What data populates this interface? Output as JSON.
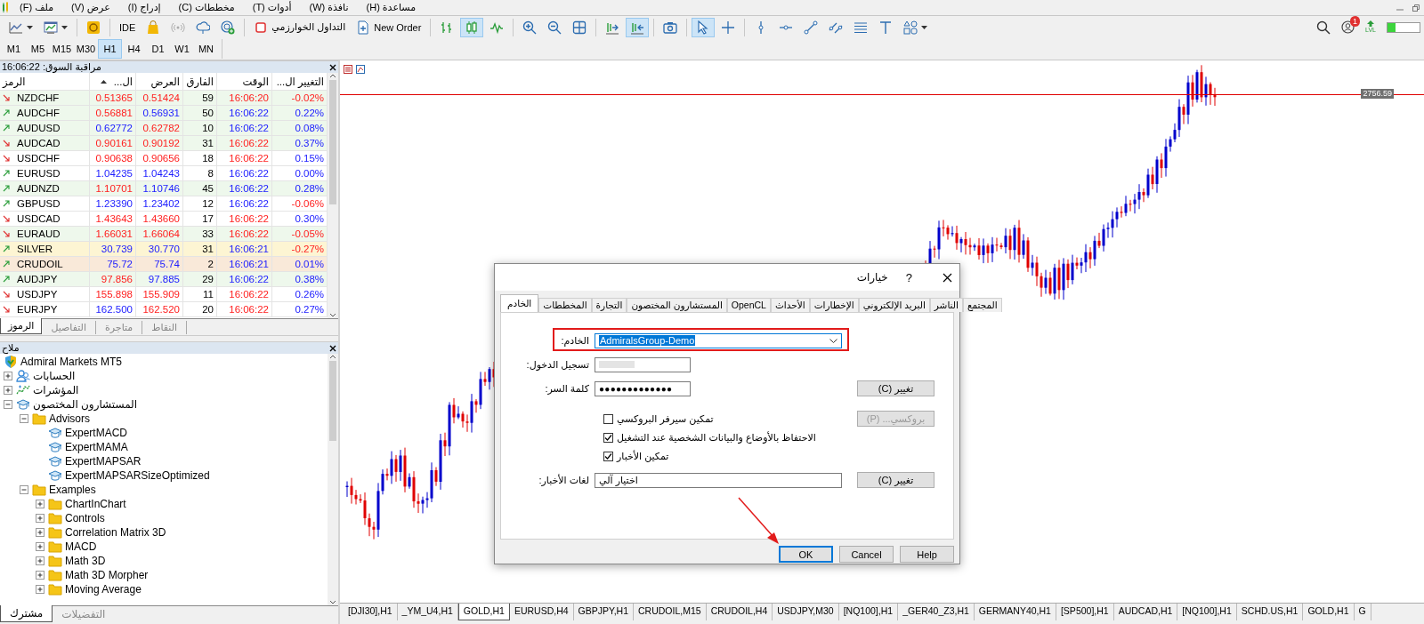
{
  "menu_bar": {
    "items": [
      "مساعدة (H)",
      "نافذة (W)",
      "أدوات (T)",
      "مخططات (C)",
      "إدراج (I)",
      "عرض (V)",
      "ملف (F)"
    ]
  },
  "toolbar": {
    "buttons": [
      {
        "kind": "line-dropdown",
        "selected": false
      },
      {
        "kind": "chart-dropdown",
        "selected": false
      },
      {
        "kind": "coin",
        "selected": false
      },
      {
        "kind": "ide",
        "label": "IDE",
        "selected": false
      },
      {
        "kind": "bag",
        "selected": false
      },
      {
        "kind": "broadcast",
        "selected": false
      },
      {
        "kind": "cloud",
        "selected": false
      },
      {
        "kind": "radar",
        "selected": false
      },
      {
        "kind": "algo",
        "label": "التداول الخوارزمي",
        "selected": false
      },
      {
        "kind": "new-order",
        "label": "New Order",
        "selected": false
      },
      {
        "kind": "bars",
        "selected": false
      },
      {
        "kind": "candles",
        "selected": true
      },
      {
        "kind": "line",
        "selected": false
      },
      {
        "kind": "zoom-in",
        "selected": false
      },
      {
        "kind": "zoom-out",
        "selected": false
      },
      {
        "kind": "tile",
        "selected": false
      },
      {
        "kind": "autoscroll",
        "selected": false
      },
      {
        "kind": "shift",
        "selected": true
      },
      {
        "kind": "camera",
        "selected": false
      },
      {
        "kind": "cursor",
        "selected": true
      },
      {
        "kind": "crosshair",
        "selected": false
      },
      {
        "kind": "vline",
        "selected": false
      },
      {
        "kind": "hline",
        "selected": false
      },
      {
        "kind": "trend",
        "selected": false
      },
      {
        "kind": "channel",
        "selected": false
      },
      {
        "kind": "fibo",
        "selected": false
      },
      {
        "kind": "text",
        "selected": false
      },
      {
        "kind": "shapes",
        "selected": false
      }
    ]
  },
  "status": {
    "notifications": "1",
    "level_label": "LVL",
    "level": 0.25
  },
  "timeframes": [
    {
      "label": "M1",
      "selected": false
    },
    {
      "label": "M5",
      "selected": false
    },
    {
      "label": "M15",
      "selected": false
    },
    {
      "label": "M30",
      "selected": false
    },
    {
      "label": "H1",
      "selected": true
    },
    {
      "label": "H4",
      "selected": false
    },
    {
      "label": "D1",
      "selected": false
    },
    {
      "label": "W1",
      "selected": false
    },
    {
      "label": "MN",
      "selected": false
    }
  ],
  "market_watch": {
    "title": "مراقبة السوق: 16:06:22",
    "columns": [
      {
        "label": "التغيير ال...",
        "sorted": false
      },
      {
        "label": "الوقت",
        "sorted": false
      },
      {
        "label": "الفارق",
        "sorted": false
      },
      {
        "label": "العرض",
        "sorted": false
      },
      {
        "label": "ال...",
        "sorted": true
      },
      {
        "label": "الرمز",
        "sorted": false
      }
    ],
    "rows": [
      {
        "symbol": "NZDCHF",
        "trend_up": false,
        "bid": "0.51365",
        "bid_up": false,
        "ask": "0.51424",
        "ask_up": false,
        "spread": "59",
        "time": "16:06:20",
        "time_up": false,
        "change": "-0.02%",
        "change_up": false,
        "color": "#eef8ec"
      },
      {
        "symbol": "AUDCHF",
        "trend_up": true,
        "bid": "0.56881",
        "bid_up": false,
        "ask": "0.56931",
        "ask_up": true,
        "spread": "50",
        "time": "16:06:22",
        "time_up": true,
        "change": "0.22%",
        "change_up": true,
        "color": "#eef8ec"
      },
      {
        "symbol": "AUDUSD",
        "trend_up": true,
        "bid": "0.62772",
        "bid_up": true,
        "ask": "0.62782",
        "ask_up": false,
        "spread": "10",
        "time": "16:06:22",
        "time_up": true,
        "change": "0.08%",
        "change_up": true,
        "color": "#eef8ec"
      },
      {
        "symbol": "AUDCAD",
        "trend_up": false,
        "bid": "0.90161",
        "bid_up": false,
        "ask": "0.90192",
        "ask_up": false,
        "spread": "31",
        "time": "16:06:22",
        "time_up": false,
        "change": "0.37%",
        "change_up": true,
        "color": "#eef8ec"
      },
      {
        "symbol": "USDCHF",
        "trend_up": false,
        "bid": "0.90638",
        "bid_up": false,
        "ask": "0.90656",
        "ask_up": false,
        "spread": "18",
        "time": "16:06:22",
        "time_up": false,
        "change": "0.15%",
        "change_up": true,
        "color": "#ffffff"
      },
      {
        "symbol": "EURUSD",
        "trend_up": true,
        "bid": "1.04235",
        "bid_up": true,
        "ask": "1.04243",
        "ask_up": true,
        "spread": "8",
        "time": "16:06:22",
        "time_up": true,
        "change": "0.00%",
        "change_up": true,
        "color": "#ffffff"
      },
      {
        "symbol": "AUDNZD",
        "trend_up": true,
        "bid": "1.10701",
        "bid_up": false,
        "ask": "1.10746",
        "ask_up": true,
        "spread": "45",
        "time": "16:06:22",
        "time_up": true,
        "change": "0.28%",
        "change_up": true,
        "color": "#eef8ec"
      },
      {
        "symbol": "GBPUSD",
        "trend_up": true,
        "bid": "1.23390",
        "bid_up": true,
        "ask": "1.23402",
        "ask_up": true,
        "spread": "12",
        "time": "16:06:22",
        "time_up": true,
        "change": "-0.06%",
        "change_up": false,
        "color": "#ffffff"
      },
      {
        "symbol": "USDCAD",
        "trend_up": false,
        "bid": "1.43643",
        "bid_up": false,
        "ask": "1.43660",
        "ask_up": false,
        "spread": "17",
        "time": "16:06:22",
        "time_up": false,
        "change": "0.30%",
        "change_up": true,
        "color": "#ffffff"
      },
      {
        "symbol": "EURAUD",
        "trend_up": false,
        "bid": "1.66031",
        "bid_up": false,
        "ask": "1.66064",
        "ask_up": false,
        "spread": "33",
        "time": "16:06:22",
        "time_up": false,
        "change": "-0.05%",
        "change_up": false,
        "color": "#eef8ec"
      },
      {
        "symbol": "SILVER",
        "trend_up": true,
        "bid": "30.739",
        "bid_up": true,
        "ask": "30.770",
        "ask_up": true,
        "spread": "31",
        "time": "16:06:21",
        "time_up": true,
        "change": "-0.27%",
        "change_up": false,
        "color": "#fdf5d3"
      },
      {
        "symbol": "CRUDOIL",
        "trend_up": true,
        "bid": "75.72",
        "bid_up": true,
        "ask": "75.74",
        "ask_up": true,
        "spread": "2",
        "time": "16:06:21",
        "time_up": true,
        "change": "0.01%",
        "change_up": true,
        "color": "#f9e9d9"
      },
      {
        "symbol": "AUDJPY",
        "trend_up": true,
        "bid": "97.856",
        "bid_up": false,
        "ask": "97.885",
        "ask_up": true,
        "spread": "29",
        "time": "16:06:22",
        "time_up": true,
        "change": "0.38%",
        "change_up": true,
        "color": "#eef8ec"
      },
      {
        "symbol": "USDJPY",
        "trend_up": false,
        "bid": "155.898",
        "bid_up": false,
        "ask": "155.909",
        "ask_up": false,
        "spread": "11",
        "time": "16:06:22",
        "time_up": false,
        "change": "0.26%",
        "change_up": true,
        "color": "#ffffff"
      },
      {
        "symbol": "EURJPY",
        "trend_up": false,
        "bid": "162.500",
        "bid_up": true,
        "ask": "162.520",
        "ask_up": false,
        "spread": "20",
        "time": "16:06:22",
        "time_up": false,
        "change": "0.27%",
        "change_up": true,
        "color": "#ffffff"
      }
    ],
    "tabs": [
      {
        "label": "النقاط",
        "selected": false
      },
      {
        "label": "متاجرة",
        "selected": false
      },
      {
        "label": "التفاصيل",
        "selected": false
      },
      {
        "label": "الرموز",
        "selected": true
      }
    ]
  },
  "navigator": {
    "title": "ملاح",
    "tree": [
      {
        "label": "Admiral Markets MT5",
        "kind": "broker",
        "children": [
          {
            "label": "الحسابات",
            "kind": "accounts",
            "expanded": false
          },
          {
            "label": "المؤشرات",
            "kind": "indicators",
            "expanded": false
          },
          {
            "label": "المستشارون المختصون",
            "kind": "experts",
            "expanded": true,
            "children": [
              {
                "label": "Advisors",
                "kind": "folder",
                "expanded": true,
                "children": [
                  {
                    "label": "ExpertMACD",
                    "kind": "expert"
                  },
                  {
                    "label": "ExpertMAMA",
                    "kind": "expert"
                  },
                  {
                    "label": "ExpertMAPSAR",
                    "kind": "expert"
                  },
                  {
                    "label": "ExpertMAPSARSizeOptimized",
                    "kind": "expert"
                  }
                ]
              },
              {
                "label": "Examples",
                "kind": "folder",
                "expanded": true,
                "children": [
                  {
                    "label": "ChartInChart",
                    "kind": "folder",
                    "expanded": false
                  },
                  {
                    "label": "Controls",
                    "kind": "folder",
                    "expanded": false
                  },
                  {
                    "label": "Correlation Matrix 3D",
                    "kind": "folder",
                    "expanded": false
                  },
                  {
                    "label": "MACD",
                    "kind": "folder",
                    "expanded": false
                  },
                  {
                    "label": "Math 3D",
                    "kind": "folder",
                    "expanded": false
                  },
                  {
                    "label": "Math 3D Morpher",
                    "kind": "folder",
                    "expanded": false
                  },
                  {
                    "label": "Moving Average",
                    "kind": "folder",
                    "expanded": false
                  }
                ]
              }
            ]
          }
        ]
      }
    ],
    "tabs": [
      {
        "label": "التفضيلات",
        "selected": false
      },
      {
        "label": "مشترك",
        "selected": true
      }
    ]
  },
  "chart": {
    "price_label": "2756.59"
  },
  "chart_tabs": [
    {
      "label": "[DJI30],H1",
      "selected": false
    },
    {
      "label": "_YM_U4,H1",
      "selected": false
    },
    {
      "label": "GOLD,H1",
      "selected": true
    },
    {
      "label": "EURUSD,H4",
      "selected": false
    },
    {
      "label": "GBPJPY,H1",
      "selected": false
    },
    {
      "label": "CRUDOIL,M15",
      "selected": false
    },
    {
      "label": "CRUDOIL,H4",
      "selected": false
    },
    {
      "label": "USDJPY,M30",
      "selected": false
    },
    {
      "label": "[NQ100],H1",
      "selected": false
    },
    {
      "label": "_GER40_Z3,H1",
      "selected": false
    },
    {
      "label": "GERMANY40,H1",
      "selected": false
    },
    {
      "label": "[SP500],H1",
      "selected": false
    },
    {
      "label": "AUDCAD,H1",
      "selected": false
    },
    {
      "label": "[NQ100],H1",
      "selected": false
    },
    {
      "label": "SCHD.US,H1",
      "selected": false
    },
    {
      "label": "GOLD,H1",
      "selected": false
    },
    {
      "label": "G",
      "selected": false
    }
  ],
  "dialog": {
    "title": "خيارات",
    "help": "?",
    "tabs": [
      {
        "label": "المجتمع",
        "selected": false
      },
      {
        "label": "الناشر",
        "selected": false
      },
      {
        "label": "البريد الإلكتروني",
        "selected": false
      },
      {
        "label": "الإخطارات",
        "selected": false
      },
      {
        "label": "الأحداث",
        "selected": false
      },
      {
        "label": "OpenCL",
        "selected": false
      },
      {
        "label": "المستشارون المختصون",
        "selected": false
      },
      {
        "label": "التجارة",
        "selected": false
      },
      {
        "label": "المخططات",
        "selected": false
      },
      {
        "label": "الخادم",
        "selected": true
      }
    ],
    "server": {
      "label": "الخادم:",
      "value": "AdmiralsGroup-Demo",
      "highlighted": true
    },
    "login": {
      "label": "تسجيل الدخول:",
      "redacted": true
    },
    "password": {
      "label": "كلمة السر:",
      "value": "●●●●●●●●●●●●●",
      "button": "تغيير (C)"
    },
    "checkboxes": [
      {
        "label": "تمكين سيرفر البروكسي",
        "checked": false
      },
      {
        "label": "الاحتفاظ بالأوضاع والبيانات الشخصية عند التشغيل",
        "checked": true
      },
      {
        "label": "تمكين الأخبار",
        "checked": true
      }
    ],
    "proxy_button": {
      "label": "بروكسي... (P)",
      "disabled": true
    },
    "news_language": {
      "label": "لغات الأخبار:",
      "value": "اختيار آلي",
      "button": "تغيير (C)"
    },
    "buttons": [
      {
        "label": "OK",
        "selected": true
      },
      {
        "label": "Cancel",
        "selected": false
      },
      {
        "label": "Help",
        "selected": false
      }
    ]
  }
}
